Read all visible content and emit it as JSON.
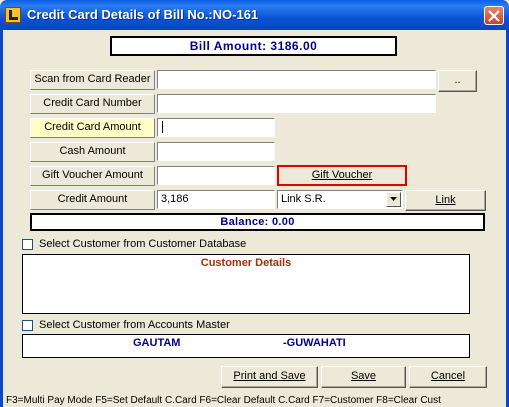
{
  "window": {
    "title": "Credit Card Details of Bill No.:NO-161"
  },
  "bill_amount": "Bill Amount: 3186.00",
  "fields": {
    "scan_label": "Scan from Card Reader",
    "scan_value": "",
    "browse_label": "..",
    "card_number_label": "Credit Card Number",
    "card_number_value": "",
    "card_amount_label": "Credit Card Amount",
    "card_amount_value": "",
    "cash_label": "Cash Amount",
    "cash_value": "",
    "gift_label": "Gift Voucher Amount",
    "gift_value": "",
    "gift_button_label": "Gift Voucher",
    "credit_label": "Credit Amount",
    "credit_value": "3,186",
    "link_select_value": "Link S.R.",
    "link_button_label": "Link"
  },
  "balance": "Balance: 0.00",
  "customer_db": {
    "checkbox_label": "Select Customer from Customer Database",
    "panel_title": "Customer Details"
  },
  "accounts_master": {
    "checkbox_label": "Select Customer from Accounts Master",
    "name": "GAUTAM",
    "place": "-GUWAHATI"
  },
  "buttons": {
    "print_save": "Print and Save",
    "save": "Save",
    "cancel": "Cancel"
  },
  "status_bar": "F3=Multi Pay Mode  F5=Set Default C.Card   F6=Clear Default C.Card   F7=Customer  F8=Clear Cust",
  "colors": {
    "title_bar": "#0a5fe6",
    "accent_text": "#00008b",
    "highlight_label": "#ffffc6",
    "gift_button_border": "#e00000"
  }
}
